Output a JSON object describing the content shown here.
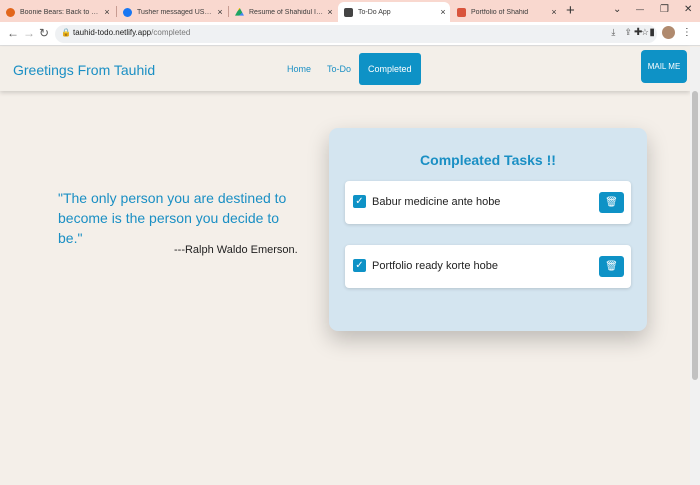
{
  "browser": {
    "tabs": [
      {
        "title": "Boonie Bears: Back to Earth",
        "color": "#e2661b"
      },
      {
        "title": "Tusher messaged USA Sunvi",
        "color": "#1877f2"
      },
      {
        "title": "Resume of Shahidul Islam .p",
        "color": "#1fa463"
      },
      {
        "title": "To-Do App",
        "color": "#444444"
      },
      {
        "title": "Portfolio of Shahid",
        "color": "#d9543c"
      }
    ],
    "new_tab": "+",
    "close": "×",
    "window_controls": {
      "chevron": "⌄",
      "minimize": "—",
      "maximize": "❐",
      "close": "✕"
    },
    "url_host": "tauhid-todo.netlify.app",
    "url_path": "/completed"
  },
  "header": {
    "brand": "Greetings From Tauhid",
    "nav": [
      {
        "label": "Home",
        "active": false
      },
      {
        "label": "To-Do",
        "active": false
      },
      {
        "label": "Completed",
        "active": true
      }
    ],
    "mail_button": "MAIL ME"
  },
  "quote": {
    "text": "\"The only person you are destined to become is the person you decide to be.\"",
    "author": "---Ralph Waldo Emerson."
  },
  "completed": {
    "title": "Compleated Tasks !!",
    "tasks": [
      {
        "text": "Babur medicine ante hobe",
        "checked": true
      },
      {
        "text": "Portfolio ready korte hobe",
        "checked": true
      }
    ]
  },
  "colors": {
    "accent": "#0e92c6",
    "background": "#f4efe9",
    "card": "#d4e5f0"
  }
}
